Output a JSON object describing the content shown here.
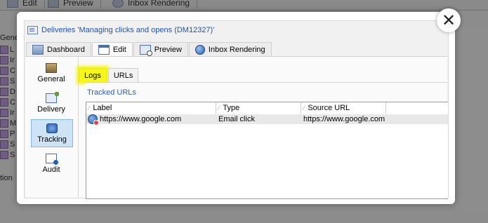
{
  "background": {
    "tabs": [
      {
        "label": "Edit"
      },
      {
        "label": "Preview"
      },
      {
        "label": "Inbox Rendering"
      }
    ],
    "side_label": "Gene",
    "rows": [
      "L",
      "Ir",
      "C",
      "S",
      "D",
      "C",
      "Ir",
      "M",
      "P",
      "S",
      "S"
    ],
    "bottom_text": "tion"
  },
  "modal": {
    "close_symbol": "✕",
    "title": "Deliveries 'Managing clicks and opens (DM12327)'",
    "tabs": [
      {
        "label": "Dashboard",
        "icon": "dashboard-icon"
      },
      {
        "label": "Edit",
        "icon": "edit-icon",
        "active": true
      },
      {
        "label": "Preview",
        "icon": "preview-icon"
      },
      {
        "label": "Inbox Rendering",
        "icon": "globe-icon"
      }
    ],
    "nav": [
      {
        "label": "General",
        "icon": "general-icon"
      },
      {
        "label": "Delivery",
        "icon": "delivery-icon"
      },
      {
        "label": "Tracking",
        "icon": "tracking-icon",
        "selected": true
      },
      {
        "label": "Audit",
        "icon": "audit-icon"
      }
    ],
    "sub_tabs": [
      {
        "label": "Logs",
        "highlighted": true
      },
      {
        "label": "URLs"
      }
    ],
    "panel_title": "Tracked URLs",
    "table": {
      "columns": [
        "Label",
        "Type",
        "Source URL"
      ],
      "rows": [
        {
          "label": "https://www.google.com",
          "type": "Email click",
          "source_url": "https://www.google.com"
        }
      ]
    }
  },
  "colors": {
    "highlight": "#f7f61a",
    "link_blue": "#2b5fae",
    "selected_nav": "#cfe3f7"
  }
}
